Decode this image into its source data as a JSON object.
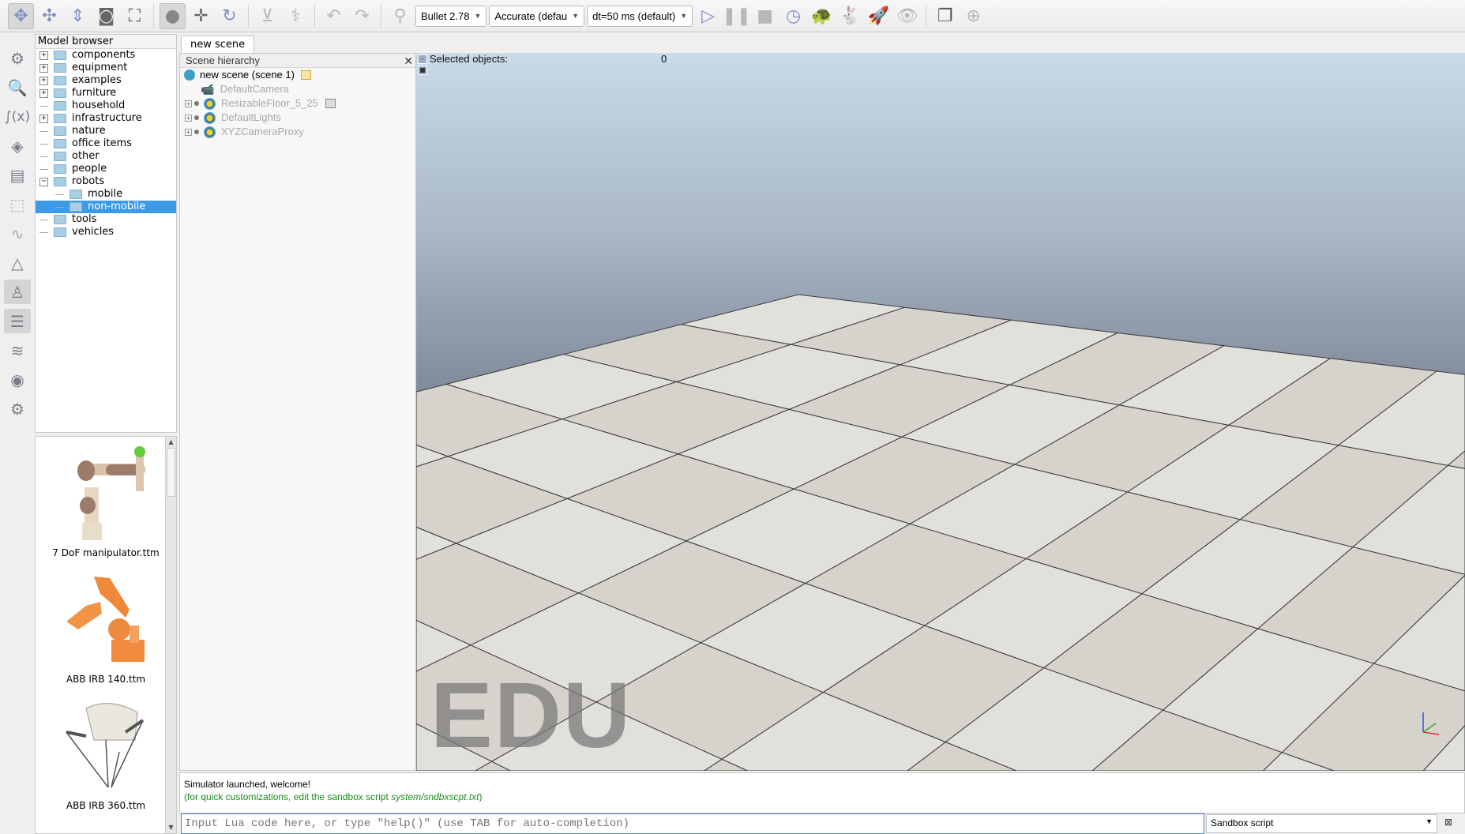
{
  "toolbar": {
    "icons": [
      "camera-pan-icon",
      "camera-rotate-icon",
      "camera-shift-icon",
      "camera-angle-icon",
      "fit-to-view-icon",
      "click-selection-icon",
      "object-shift-icon",
      "object-rotate-icon",
      "assemble-icon",
      "transfer-dna-icon",
      "undo-icon",
      "redo-icon",
      "dynamics-toggle-icon"
    ],
    "engine": "Bullet 2.78",
    "accuracy": "Accurate (defau",
    "timestep": "dt=50 ms (default)",
    "sim_icons": [
      "play-icon",
      "pause-icon",
      "stop-icon",
      "real-time-icon",
      "slow-down-icon",
      "speed-up-icon",
      "threaded-rendering-icon",
      "visualization-toggle-icon",
      "page-selector-icon",
      "scene-selector-icon"
    ]
  },
  "left_toolbar": [
    "simulation-settings-icon",
    "object-properties-icon",
    "calculation-modules-icon",
    "collections-icon",
    "scripts-icon",
    "shape-edit-icon",
    "path-edit-icon",
    "selection-icon",
    "model-browser-icon",
    "scene-hierarchy-icon",
    "layers-icon",
    "video-recorder-icon",
    "user-settings-icon"
  ],
  "model_browser": {
    "title": "Model browser",
    "items": [
      {
        "label": "components",
        "expandable": true
      },
      {
        "label": "equipment",
        "expandable": true
      },
      {
        "label": "examples",
        "expandable": true
      },
      {
        "label": "furniture",
        "expandable": true
      },
      {
        "label": "household",
        "expandable": false
      },
      {
        "label": "infrastructure",
        "expandable": true
      },
      {
        "label": "nature",
        "expandable": false
      },
      {
        "label": "office items",
        "expandable": false
      },
      {
        "label": "other",
        "expandable": false
      },
      {
        "label": "people",
        "expandable": false
      },
      {
        "label": "robots",
        "expandable": true,
        "expanded": true
      },
      {
        "label": "mobile",
        "child": true
      },
      {
        "label": "non-mobile",
        "child": true,
        "selected": true
      },
      {
        "label": "tools",
        "expandable": false
      },
      {
        "label": "vehicles",
        "expandable": false
      }
    ],
    "thumbnails": [
      "7 DoF manipulator.ttm",
      "ABB IRB 140.ttm",
      "ABB IRB 360.ttm"
    ]
  },
  "scene_tab": "new scene",
  "hierarchy": {
    "title": "Scene hierarchy",
    "root": "new scene (scene 1)",
    "objects": [
      "DefaultCamera",
      "ResizableFloor_5_25",
      "DefaultLights",
      "XYZCameraProxy"
    ]
  },
  "viewport": {
    "selected_label": "Selected objects:",
    "selected_count": "0",
    "watermark": "EDU"
  },
  "console": {
    "line1": "Simulator launched, welcome!",
    "line2_prefix": "(for quick customizations, edit the sandbox script ",
    "line2_path": "system/sndbxscpt.txt",
    "line2_suffix": ")",
    "input_placeholder": "Input Lua code here, or type \"help()\" (use TAB for auto-completion)",
    "script_selector": "Sandbox script"
  },
  "colors": {
    "selection": "#3d9ae8",
    "console_green": "#1a8a1a",
    "folder": "#a9cfe4"
  }
}
